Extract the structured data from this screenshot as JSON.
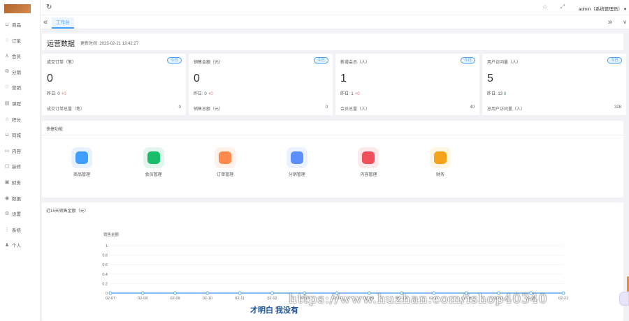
{
  "sidebar": {
    "items": [
      {
        "label": "商品",
        "icon": "bag-icon"
      },
      {
        "label": "订单",
        "icon": "bell-icon"
      },
      {
        "label": "会员",
        "icon": "user-icon"
      },
      {
        "label": "分销",
        "icon": "share-icon"
      },
      {
        "label": "营销",
        "icon": "heart-icon"
      },
      {
        "label": "课程",
        "icon": "book-icon"
      },
      {
        "label": "积分",
        "icon": "star-icon"
      },
      {
        "label": "同城",
        "icon": "location-icon"
      },
      {
        "label": "内容",
        "icon": "folder-icon"
      },
      {
        "label": "装修",
        "icon": "palette-icon"
      },
      {
        "label": "财务",
        "icon": "wallet-icon"
      },
      {
        "label": "数据",
        "icon": "chart-icon"
      },
      {
        "label": "设置",
        "icon": "gear-icon"
      },
      {
        "label": "系统",
        "icon": "system-icon"
      },
      {
        "label": "个人",
        "icon": "person-icon"
      }
    ]
  },
  "header": {
    "user": "admin（系统管理员）"
  },
  "tabs": {
    "active": "工作台"
  },
  "ops": {
    "title": "运营数据",
    "updated_label": "更新时间:",
    "updated_time": "2023-02-21 13:42:27"
  },
  "stats": [
    {
      "label": "成交订单（笔）",
      "badge": "今日",
      "value": "0",
      "yesterday_label": "昨日:",
      "yesterday_value": "0",
      "delta": "+0",
      "total_label": "成交订单总量（笔）",
      "total": "0"
    },
    {
      "label": "销售金额（元）",
      "badge": "今日",
      "value": "0",
      "yesterday_label": "昨日:",
      "yesterday_value": "0",
      "delta": "+0",
      "total_label": "销售总额（元）",
      "total": "0"
    },
    {
      "label": "新增会员（人）",
      "badge": "今日",
      "value": "1",
      "yesterday_label": "昨日:",
      "yesterday_value": "1",
      "delta": "+0",
      "total_label": "会员总量（人）",
      "total": "40"
    },
    {
      "label": "用户访问量（人）",
      "badge": "今日",
      "value": "5",
      "yesterday_label": "昨日:",
      "yesterday_value": "13",
      "delta": "8",
      "total_label": "总用户访问量（人）",
      "total": "328"
    }
  ],
  "quick": {
    "title": "快捷功能",
    "items": [
      {
        "label": "商品管理",
        "icon": "shopping-bag-icon",
        "color": "#409eff",
        "bg": "#e8f2ff"
      },
      {
        "label": "会员管理",
        "icon": "users-icon",
        "color": "#19be6b",
        "bg": "#e3f6ee"
      },
      {
        "label": "订单管理",
        "icon": "order-icon",
        "color": "#ff8a4c",
        "bg": "#fff0e8"
      },
      {
        "label": "分销管理",
        "icon": "megaphone-icon",
        "color": "#5b8ff9",
        "bg": "#ebf1ff"
      },
      {
        "label": "内容管理",
        "icon": "content-icon",
        "color": "#f0505a",
        "bg": "#fde9ea"
      },
      {
        "label": "财务",
        "icon": "finance-icon",
        "color": "#f7a21b",
        "bg": "#fff5e3"
      }
    ]
  },
  "chart_data": {
    "type": "line",
    "title": "近15天销售金额（元）",
    "ylabel": "销售金额",
    "ylim": [
      0,
      1
    ],
    "yticks": [
      "0",
      "0.2",
      "0.4",
      "0.6",
      "0.8",
      "1"
    ],
    "x": [
      "02-07",
      "02-08",
      "02-09",
      "02-10",
      "02-11",
      "02-12",
      "02-13",
      "02-14",
      "02-15",
      "02-16",
      "02-17",
      "02-18",
      "02-19",
      "02-20",
      "02-21"
    ],
    "series": [
      {
        "values": [
          0,
          0,
          0,
          0,
          0,
          0,
          0,
          0,
          0,
          0,
          0,
          0,
          0,
          0,
          0
        ],
        "color": "#5ba8f0"
      }
    ]
  },
  "watermark": {
    "url": "https://www.huzhan.com/ishop40340",
    "caption": "才明白 我没有"
  }
}
